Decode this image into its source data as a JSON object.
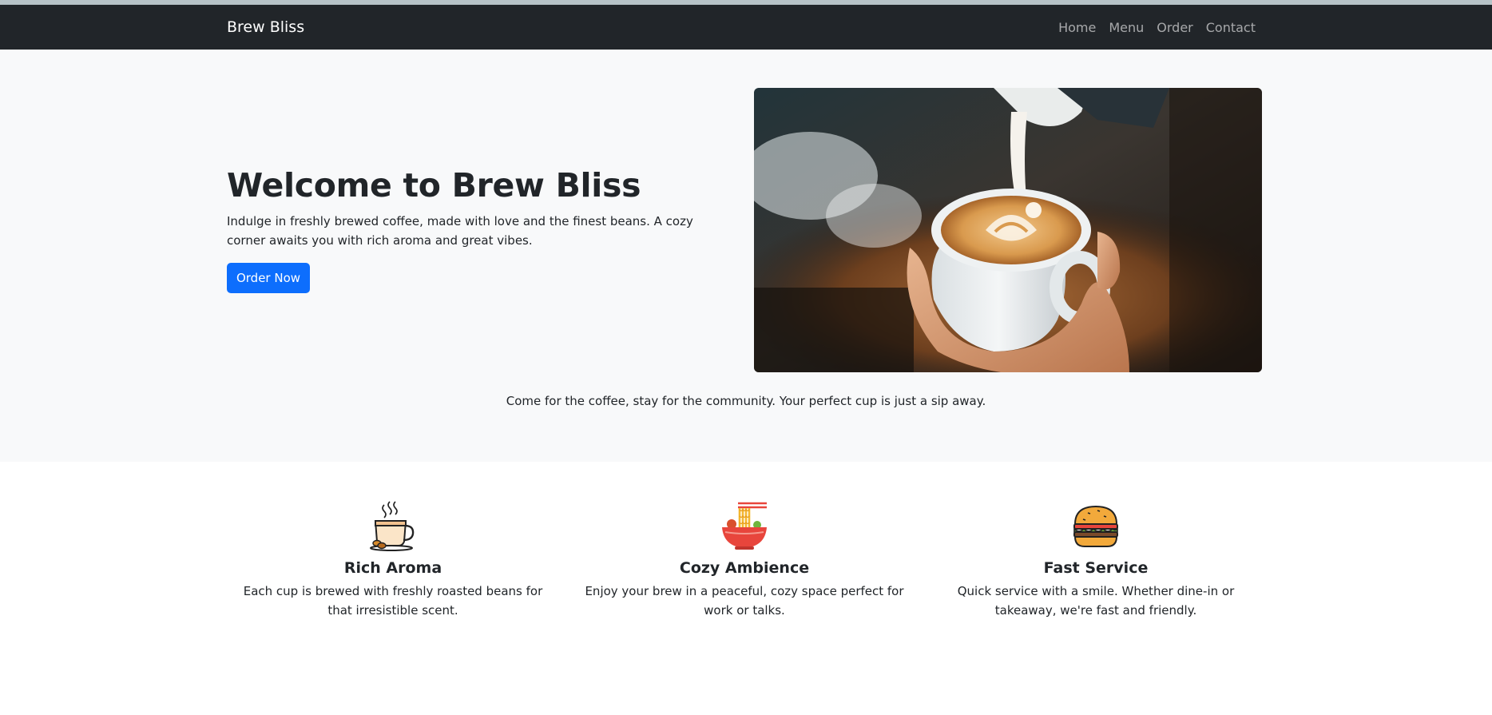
{
  "navbar": {
    "brand": "Brew Bliss",
    "links": [
      "Home",
      "Menu",
      "Order",
      "Contact"
    ]
  },
  "hero": {
    "title": "Welcome to Brew Bliss",
    "text": "Indulge in freshly brewed coffee, made with love and the finest beans. A cozy corner awaits you with rich aroma and great vibes.",
    "button_label": "Order Now",
    "image_icon": "latte-art-photo",
    "caption": "Come for the coffee, stay for the community. Your perfect cup is just a sip away."
  },
  "features": [
    {
      "icon": "coffee-cup-icon",
      "title": "Rich Aroma",
      "text": "Each cup is brewed with freshly roasted beans for that irresistible scent."
    },
    {
      "icon": "noodle-bowl-icon",
      "title": "Cozy Ambience",
      "text": "Enjoy your brew in a peaceful, cozy space perfect for work or talks."
    },
    {
      "icon": "burger-icon",
      "title": "Fast Service",
      "text": "Quick service with a smile. Whether dine-in or takeaway, we're fast and friendly."
    }
  ],
  "colors": {
    "navbar_bg": "#212529",
    "hero_bg": "#f8f9fa",
    "primary": "#0d6efd"
  }
}
